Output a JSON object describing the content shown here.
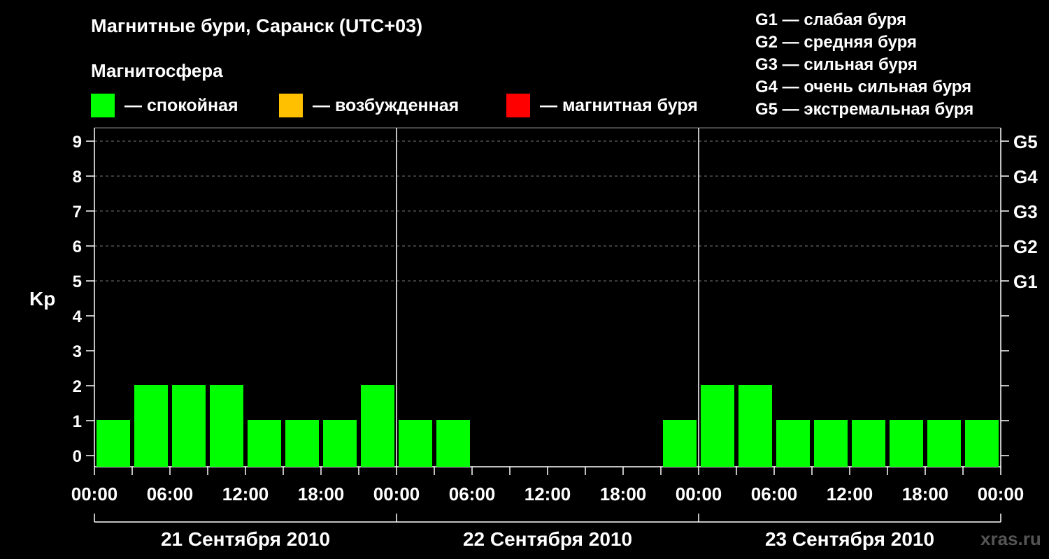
{
  "header": {
    "title": "Магнитные бури, Саранск (UTC+03)",
    "subtitle": "Магнитосфера"
  },
  "legend": {
    "calm": {
      "label": "— спокойная",
      "color": "#00ff00"
    },
    "excited": {
      "label": "— возбужденная",
      "color": "#ffc000"
    },
    "storm": {
      "label": "— магнитная буря",
      "color": "#ff0000"
    }
  },
  "g_legend": [
    "G1 — слабая буря",
    "G2 — средняя буря",
    "G3 — сильная буря",
    "G4 — очень сильная буря",
    "G5 — экстремальная буря"
  ],
  "watermark": "xras.ru",
  "chart_data": {
    "type": "bar",
    "ylabel": "Kp",
    "ylim": [
      0,
      9
    ],
    "y_ticks": [
      0,
      1,
      2,
      3,
      4,
      5,
      6,
      7,
      8,
      9
    ],
    "g_scale_labels": [
      {
        "value": 5,
        "label": "G1"
      },
      {
        "value": 6,
        "label": "G2"
      },
      {
        "value": 7,
        "label": "G3"
      },
      {
        "value": 8,
        "label": "G4"
      },
      {
        "value": 9,
        "label": "G5"
      }
    ],
    "x_tick_labels": [
      "00:00",
      "06:00",
      "12:00",
      "18:00",
      "00:00",
      "06:00",
      "12:00",
      "18:00",
      "00:00",
      "06:00",
      "12:00",
      "18:00",
      "00:00"
    ],
    "days": [
      "21 Сентября 2010",
      "22 Сентября 2010",
      "23 Сентября 2010"
    ],
    "categories": [
      "21 00-03",
      "21 03-06",
      "21 06-09",
      "21 09-12",
      "21 12-15",
      "21 15-18",
      "21 18-21",
      "21 21-24",
      "22 00-03",
      "22 03-06",
      "22 06-09",
      "22 09-12",
      "22 12-15",
      "22 15-18",
      "22 18-21",
      "22 21-24",
      "23 00-03",
      "23 03-06",
      "23 06-09",
      "23 09-12",
      "23 12-15",
      "23 15-18",
      "23 18-21",
      "23 21-24"
    ],
    "values": [
      1,
      2,
      2,
      2,
      1,
      1,
      1,
      2,
      1,
      1,
      0,
      0,
      0,
      0,
      0,
      1,
      2,
      2,
      1,
      1,
      1,
      1,
      1,
      1
    ],
    "bar_color": "#00ff00",
    "grid": true
  }
}
